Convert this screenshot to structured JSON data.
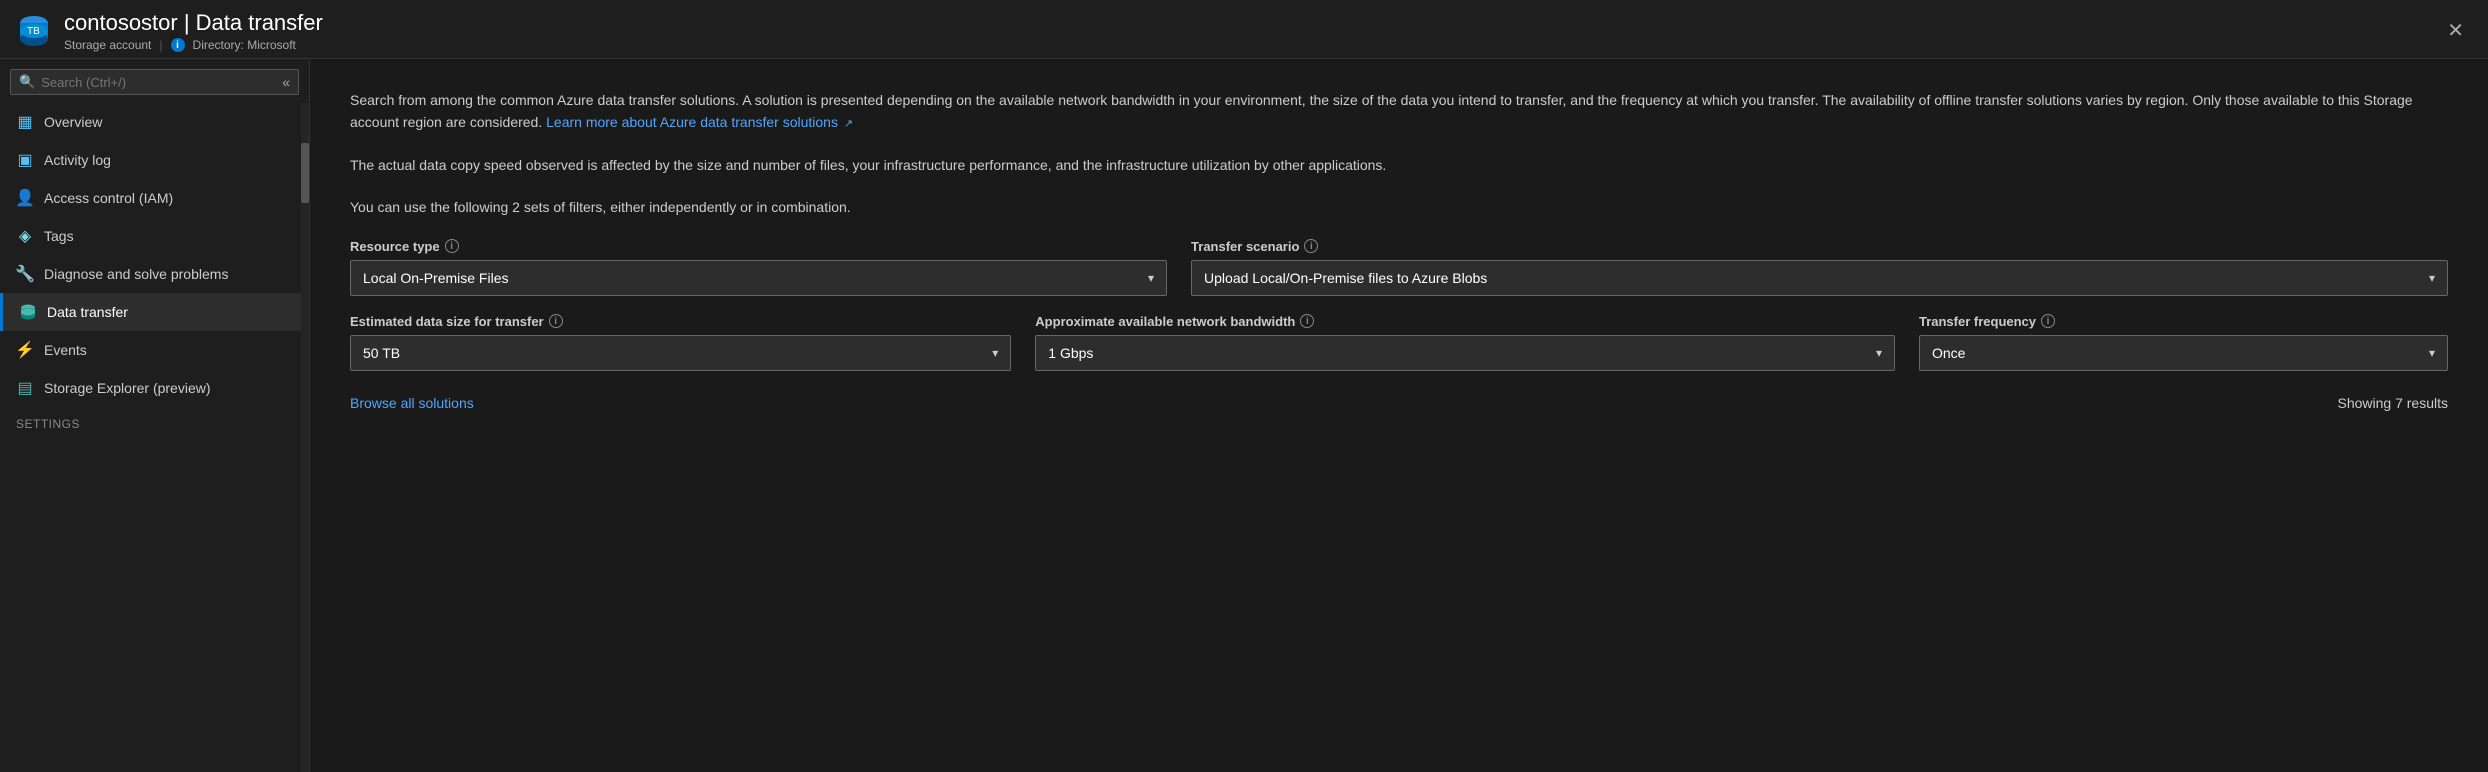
{
  "titlebar": {
    "icon_alt": "storage-account-icon",
    "title": "contosostor | Data transfer",
    "subtitle": "Storage account",
    "directory_label": "Directory: Microsoft",
    "close_label": "✕"
  },
  "sidebar": {
    "search_placeholder": "Search (Ctrl+/)",
    "collapse_icon": "«",
    "nav_items": [
      {
        "id": "overview",
        "label": "Overview",
        "icon": "▦",
        "icon_class": "icon-overview",
        "active": false
      },
      {
        "id": "activity-log",
        "label": "Activity log",
        "icon": "▣",
        "icon_class": "icon-activity",
        "active": false
      },
      {
        "id": "iam",
        "label": "Access control (IAM)",
        "icon": "👤",
        "icon_class": "icon-iam",
        "active": false
      },
      {
        "id": "tags",
        "label": "Tags",
        "icon": "◈",
        "icon_class": "icon-tags",
        "active": false
      },
      {
        "id": "diagnose",
        "label": "Diagnose and solve problems",
        "icon": "🔧",
        "icon_class": "icon-diagnose",
        "active": false
      },
      {
        "id": "data-transfer",
        "label": "Data transfer",
        "icon": "🗄",
        "icon_class": "icon-datatransfer",
        "active": true
      },
      {
        "id": "events",
        "label": "Events",
        "icon": "⚡",
        "icon_class": "icon-events",
        "active": false
      },
      {
        "id": "storage-explorer",
        "label": "Storage Explorer (preview)",
        "icon": "▤",
        "icon_class": "icon-storage",
        "active": false
      }
    ],
    "settings_header": "Settings"
  },
  "content": {
    "description1": "Search from among the common Azure data transfer solutions. A solution is presented depending on the available network bandwidth in your environment, the size of the data you intend to transfer, and the frequency at which you transfer. The availability of offline transfer solutions varies by region. Only those available to this Storage account region are considered.",
    "learn_more_label": "Learn more about Azure data transfer solutions",
    "learn_more_icon": "↗",
    "description2": "The actual data copy speed observed is affected by the size and number of files, your infrastructure performance, and the infrastructure utilization by other applications.",
    "description3": "You can use the following 2 sets of filters, either independently or in combination.",
    "filters": {
      "row1": [
        {
          "id": "resource-type",
          "label": "Resource type",
          "value": "Local On-Premise Files",
          "has_info": true
        },
        {
          "id": "transfer-scenario",
          "label": "Transfer scenario",
          "value": "Upload Local/On-Premise files to Azure Blobs",
          "has_info": true
        }
      ],
      "row2": [
        {
          "id": "data-size",
          "label": "Estimated data size for transfer",
          "value": "50 TB",
          "has_info": true
        },
        {
          "id": "bandwidth",
          "label": "Approximate available network bandwidth",
          "value": "1 Gbps",
          "has_info": true
        },
        {
          "id": "frequency",
          "label": "Transfer frequency",
          "value": "Once",
          "has_info": true
        }
      ]
    },
    "browse_all_label": "Browse all solutions",
    "results_count": "Showing 7 results"
  }
}
